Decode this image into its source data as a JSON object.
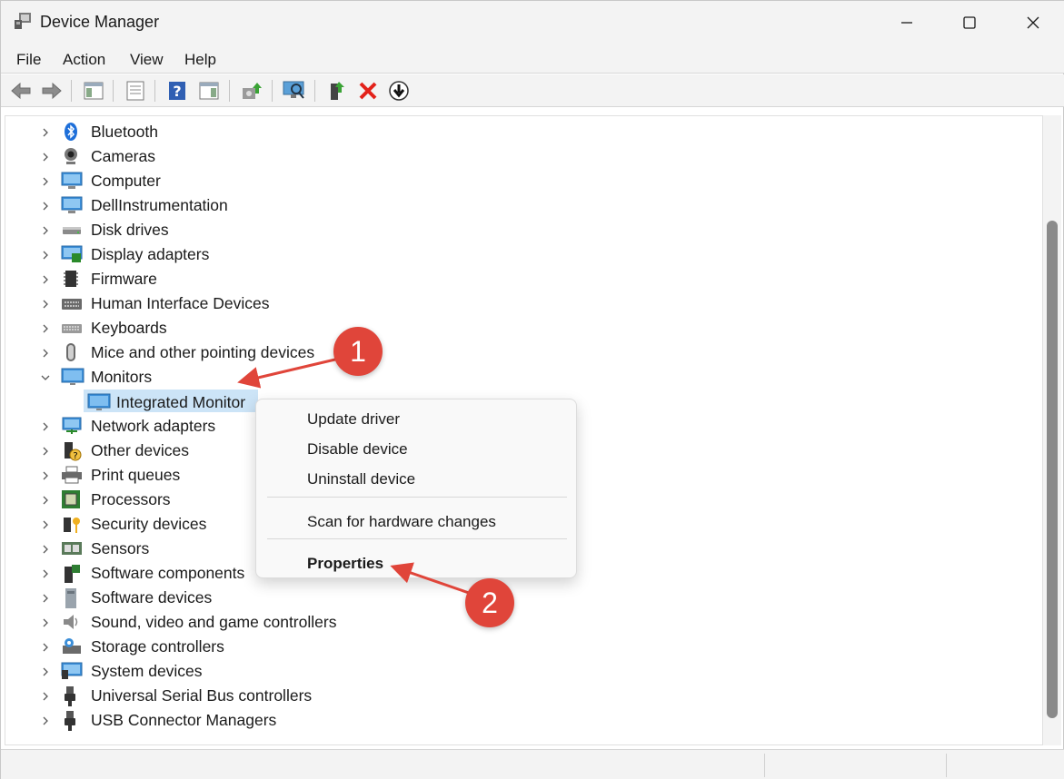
{
  "window": {
    "title": "Device Manager",
    "icon": "device-manager-icon",
    "controls": [
      "minimize-icon",
      "maximize-icon",
      "close-icon"
    ]
  },
  "menu": {
    "file": "File",
    "action": "Action",
    "view": "View",
    "help": "Help"
  },
  "toolbar": {
    "icons": [
      "back-arrow-icon",
      "forward-arrow-icon",
      "show-hide-console-tree-icon",
      "properties-icon",
      "help-icon",
      "action-pane-icon",
      "update-driver-icon",
      "scan-hardware-icon",
      "enable-device-icon",
      "uninstall-device-icon",
      "download-update-icon"
    ]
  },
  "tree": {
    "categories": [
      {
        "label": "Bluetooth",
        "icon": "bluetooth-icon"
      },
      {
        "label": "Cameras",
        "icon": "camera-icon"
      },
      {
        "label": "Computer",
        "icon": "computer-icon"
      },
      {
        "label": "DellInstrumentation",
        "icon": "computer-icon"
      },
      {
        "label": "Disk drives",
        "icon": "disk-drive-icon"
      },
      {
        "label": "Display adapters",
        "icon": "display-adapter-icon"
      },
      {
        "label": "Firmware",
        "icon": "firmware-chip-icon"
      },
      {
        "label": "Human Interface Devices",
        "icon": "hid-keyboard-icon"
      },
      {
        "label": "Keyboards",
        "icon": "keyboard-icon"
      },
      {
        "label": "Mice and other pointing devices",
        "icon": "mouse-icon"
      },
      {
        "label": "Monitors",
        "icon": "monitor-icon"
      },
      {
        "label": "Network adapters",
        "icon": "network-adapter-icon"
      },
      {
        "label": "Other devices",
        "icon": "other-device-icon"
      },
      {
        "label": "Print queues",
        "icon": "printer-icon"
      },
      {
        "label": "Processors",
        "icon": "processor-icon"
      },
      {
        "label": "Security devices",
        "icon": "security-key-icon"
      },
      {
        "label": "Sensors",
        "icon": "sensor-icon"
      },
      {
        "label": "Software components",
        "icon": "software-component-icon"
      },
      {
        "label": "Software devices",
        "icon": "software-device-icon"
      },
      {
        "label": "Sound, video and game controllers",
        "icon": "speaker-icon"
      },
      {
        "label": "Storage controllers",
        "icon": "storage-controller-icon"
      },
      {
        "label": "System devices",
        "icon": "system-device-icon"
      },
      {
        "label": "Universal Serial Bus controllers",
        "icon": "usb-icon"
      },
      {
        "label": "USB Connector Managers",
        "icon": "usb-icon"
      }
    ],
    "expanded_category": "Monitors",
    "selected_child": {
      "label": "Integrated Monitor",
      "icon": "monitor-icon"
    }
  },
  "context_menu": {
    "update_driver": "Update driver",
    "disable_device": "Disable device",
    "uninstall_device": "Uninstall device",
    "scan_hardware": "Scan for hardware changes",
    "properties": "Properties"
  },
  "annotations": {
    "step1": "1",
    "step2": "2",
    "color": "#e0453a"
  }
}
